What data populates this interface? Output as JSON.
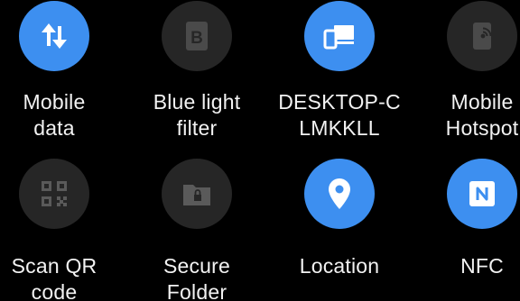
{
  "tiles": [
    {
      "line1": "Mobile",
      "line2": "data",
      "icon": "mobile-data-arrows-icon",
      "active": true
    },
    {
      "line1": "Blue light",
      "line2": "filter",
      "icon": "blue-light-filter-icon",
      "active": false
    },
    {
      "line1": "DESKTOP-C",
      "line2": "LMKKLL",
      "icon": "device-connection-icon",
      "active": true
    },
    {
      "line1": "Mobile",
      "line2": "Hotspot",
      "icon": "hotspot-icon",
      "active": false
    },
    {
      "line1": "Scan QR",
      "line2": "code",
      "icon": "qr-code-icon",
      "active": false
    },
    {
      "line1": "Secure",
      "line2": "Folder",
      "icon": "secure-folder-icon",
      "active": false
    },
    {
      "line1": "Location",
      "line2": "",
      "icon": "location-pin-icon",
      "active": true
    },
    {
      "line1": "NFC",
      "line2": "",
      "icon": "nfc-icon",
      "active": true
    }
  ],
  "colors": {
    "active": "#3d8ff0",
    "inactive": "#262626",
    "text": "#f2f2f2",
    "background": "#000000"
  }
}
